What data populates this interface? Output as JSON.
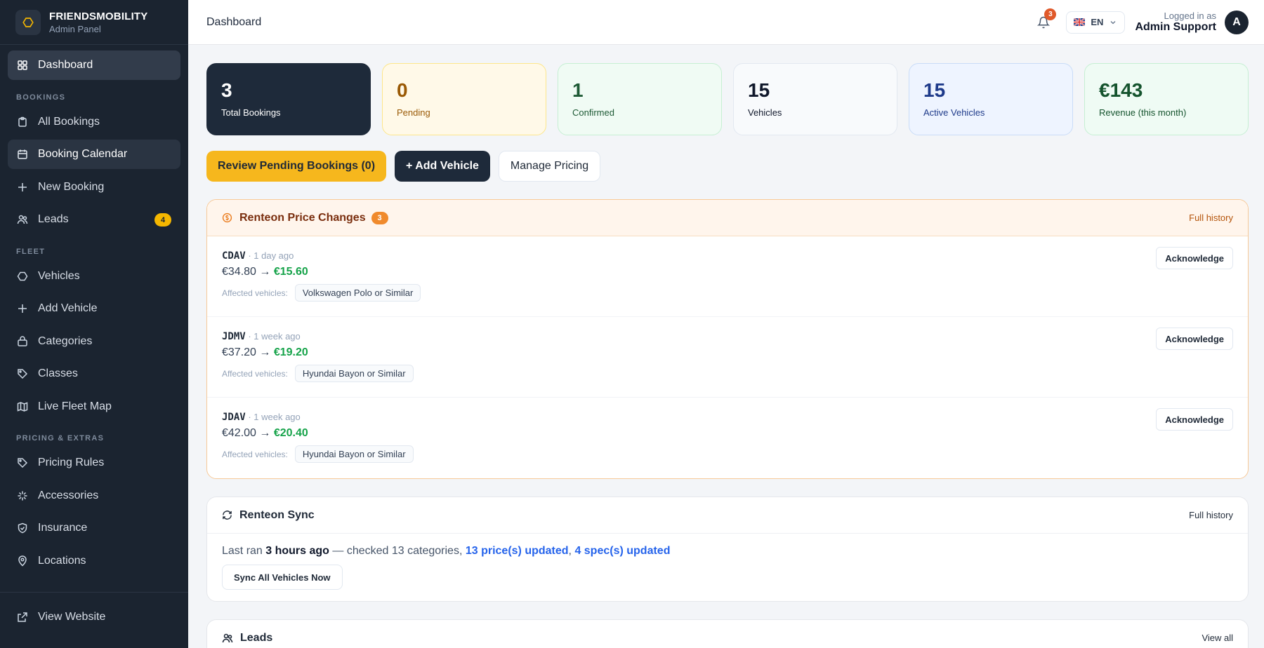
{
  "brand": {
    "name": "FRIENDSMOBILITY",
    "sub": "Admin Panel"
  },
  "nav": {
    "dashboard": "Dashboard",
    "section_bookings": "BOOKINGS",
    "all_bookings": "All Bookings",
    "booking_calendar": "Booking Calendar",
    "new_booking": "New Booking",
    "leads": "Leads",
    "leads_badge": "4",
    "section_fleet": "FLEET",
    "vehicles": "Vehicles",
    "add_vehicle": "Add Vehicle",
    "categories": "Categories",
    "classes": "Classes",
    "live_fleet_map": "Live Fleet Map",
    "section_pricing": "PRICING & EXTRAS",
    "pricing_rules": "Pricing Rules",
    "accessories": "Accessories",
    "insurance": "Insurance",
    "locations": "Locations",
    "view_website": "View Website"
  },
  "header": {
    "title": "Dashboard",
    "notif_count": "3",
    "language": "EN",
    "logged_in_as": "Logged in as",
    "user_name": "Admin Support",
    "avatar_letter": "A"
  },
  "stats": [
    {
      "value": "3",
      "label": "Total Bookings"
    },
    {
      "value": "0",
      "label": "Pending"
    },
    {
      "value": "1",
      "label": "Confirmed"
    },
    {
      "value": "15",
      "label": "Vehicles"
    },
    {
      "value": "15",
      "label": "Active Vehicles"
    },
    {
      "value": "€143",
      "label": "Revenue (this month)"
    }
  ],
  "actions": {
    "review_pending": "Review Pending Bookings (0)",
    "add_vehicle": "+ Add Vehicle",
    "manage_pricing": "Manage Pricing"
  },
  "price_changes": {
    "title": "Renteon Price Changes",
    "count": "3",
    "link": "Full history",
    "affected_label": "Affected vehicles:",
    "ack_label": "Acknowledge",
    "rows": [
      {
        "code": "CDAV",
        "when": " · 1 day ago",
        "old": "€34.80 → ",
        "new": "€15.60",
        "vehicle": "Volkswagen Polo or Similar"
      },
      {
        "code": "JDMV",
        "when": " · 1 week ago",
        "old": "€37.20 → ",
        "new": "€19.20",
        "vehicle": "Hyundai Bayon or Similar"
      },
      {
        "code": "JDAV",
        "when": " · 1 week ago",
        "old": "€42.00 → ",
        "new": "€20.40",
        "vehicle": "Hyundai Bayon or Similar"
      }
    ]
  },
  "sync": {
    "title": "Renteon Sync",
    "link": "Full history",
    "t1": "Last ran ",
    "t2": "3 hours ago",
    "t3": " — checked 13 categories, ",
    "t4": "13 price(s) updated",
    "t5": ", ",
    "t6": "4 spec(s) updated",
    "button": "Sync All Vehicles Now"
  },
  "leads_card": {
    "title": "Leads",
    "link": "View all"
  },
  "colors": {
    "sidebar": "#1b2430",
    "accent_yellow": "#f6b71d",
    "orange": "#f08a2c",
    "green": "#16a34a",
    "blue": "#2563eb"
  }
}
